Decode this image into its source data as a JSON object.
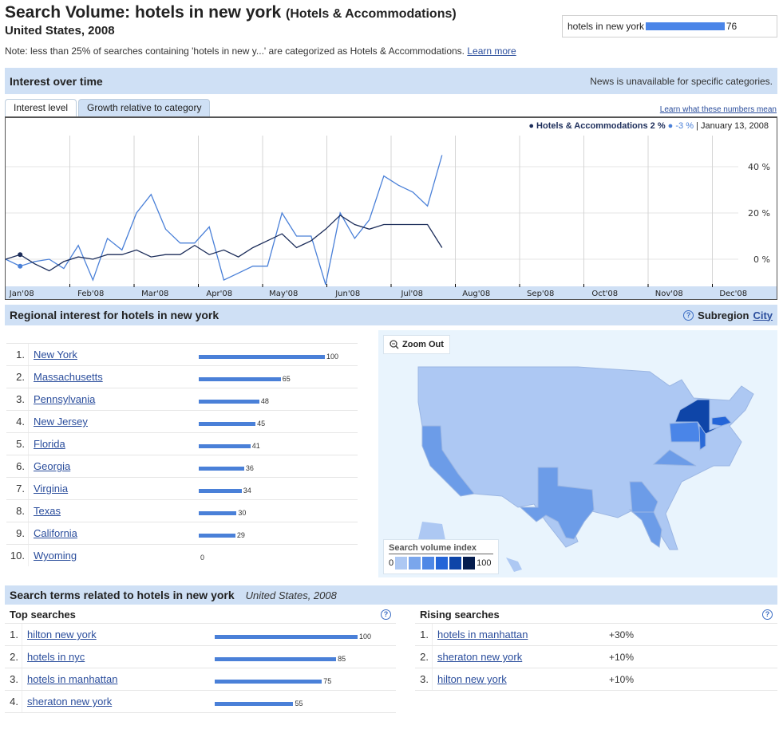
{
  "header": {
    "title": "Search Volume: hotels in new york",
    "category": "(Hotels & Accommodations)",
    "subtitle": "United States, 2008",
    "note": "Note: less than 25% of searches containing 'hotels in new y...' are categorized as Hotels & Accommodations.",
    "learn_more": "Learn more"
  },
  "searchbox": {
    "term": "hotels in new york",
    "value": 76,
    "value_label": "76",
    "bar_color": "#4a85e8"
  },
  "interest": {
    "heading": "Interest over time",
    "news_note": "News is unavailable for specific categories.",
    "tabs": [
      {
        "label": "Interest level",
        "active": false
      },
      {
        "label": "Growth relative to category",
        "active": true
      }
    ],
    "learn_numbers": "Learn what these numbers mean",
    "legend": {
      "series1": "Hotels & Accommodations 2 %",
      "series2": "-3 %",
      "date": "January 13, 2008"
    }
  },
  "chart_data": {
    "type": "line",
    "title": "Growth relative to category",
    "xlabel": "",
    "ylabel": "",
    "x_ticks": [
      "Jan'08",
      "Feb'08",
      "Mar'08",
      "Apr'08",
      "May'08",
      "Jun'08",
      "Jul'08",
      "Aug'08",
      "Sep'08",
      "Oct'08",
      "Nov'08",
      "Dec'08"
    ],
    "y_ticks": [
      "0 %",
      "20 %",
      "40 %"
    ],
    "y_tick_values": [
      0,
      20,
      40
    ],
    "ylim": [
      -12,
      53
    ],
    "weeks_total": 53,
    "grid": true,
    "series": [
      {
        "name": "Hotels & Accommodations",
        "color": "#1c2d5a",
        "values": [
          0,
          2,
          -2,
          -5,
          -1,
          1,
          0,
          2,
          2,
          4,
          1,
          2,
          2,
          6,
          2,
          4,
          1,
          5,
          8,
          11,
          5,
          8,
          13,
          19,
          15,
          13,
          15,
          15,
          15,
          15,
          5
        ]
      },
      {
        "name": "hotels in new york",
        "color": "#4a80d8",
        "values": [
          0,
          -3,
          -1,
          0,
          -4,
          6,
          -9,
          9,
          4,
          20,
          28,
          13,
          7,
          7,
          14,
          -9,
          -6,
          -3,
          -3,
          20,
          10,
          10,
          -11,
          20,
          9,
          17,
          36,
          32,
          29,
          23,
          45
        ]
      }
    ]
  },
  "regional": {
    "heading": "Regional interest  for hotels in new york",
    "subregion_label": "Subregion",
    "subregion_link": "City",
    "rows": [
      {
        "rank": "1.",
        "name": "New York",
        "value": 100,
        "label": "100"
      },
      {
        "rank": "2.",
        "name": "Massachusetts",
        "value": 65,
        "label": "65"
      },
      {
        "rank": "3.",
        "name": "Pennsylvania",
        "value": 48,
        "label": "48"
      },
      {
        "rank": "4.",
        "name": "New Jersey",
        "value": 45,
        "label": "45"
      },
      {
        "rank": "5.",
        "name": "Florida",
        "value": 41,
        "label": "41"
      },
      {
        "rank": "6.",
        "name": "Georgia",
        "value": 36,
        "label": "36"
      },
      {
        "rank": "7.",
        "name": "Virginia",
        "value": 34,
        "label": "34"
      },
      {
        "rank": "8.",
        "name": "Texas",
        "value": 30,
        "label": "30"
      },
      {
        "rank": "9.",
        "name": "California",
        "value": 29,
        "label": "29"
      },
      {
        "rank": "10.",
        "name": "Wyoming",
        "value": 0,
        "label": "0"
      }
    ],
    "zoom_out": "Zoom Out",
    "svi_label": "Search volume index",
    "svi_min": "0",
    "svi_max": "100",
    "svi_colors": [
      "#adc8f3",
      "#7aa6ec",
      "#4f88e6",
      "#2465d8",
      "#0e45a8",
      "#051d4e"
    ]
  },
  "related": {
    "heading": "Search terms related to hotels in new york",
    "scope": "United States, 2008",
    "top_title": "Top searches",
    "top": [
      {
        "rank": "1.",
        "name": "hilton new york",
        "value": 100,
        "label": "100"
      },
      {
        "rank": "2.",
        "name": "hotels in nyc",
        "value": 85,
        "label": "85"
      },
      {
        "rank": "3.",
        "name": "hotels in manhattan",
        "value": 75,
        "label": "75"
      },
      {
        "rank": "4.",
        "name": "sheraton new york",
        "value": 55,
        "label": "55"
      }
    ],
    "rising_title": "Rising searches",
    "rising": [
      {
        "rank": "1.",
        "name": "hotels in manhattan",
        "pct": "+30%"
      },
      {
        "rank": "2.",
        "name": "sheraton new york",
        "pct": "+10%"
      },
      {
        "rank": "3.",
        "name": "hilton new york",
        "pct": "+10%"
      }
    ]
  }
}
